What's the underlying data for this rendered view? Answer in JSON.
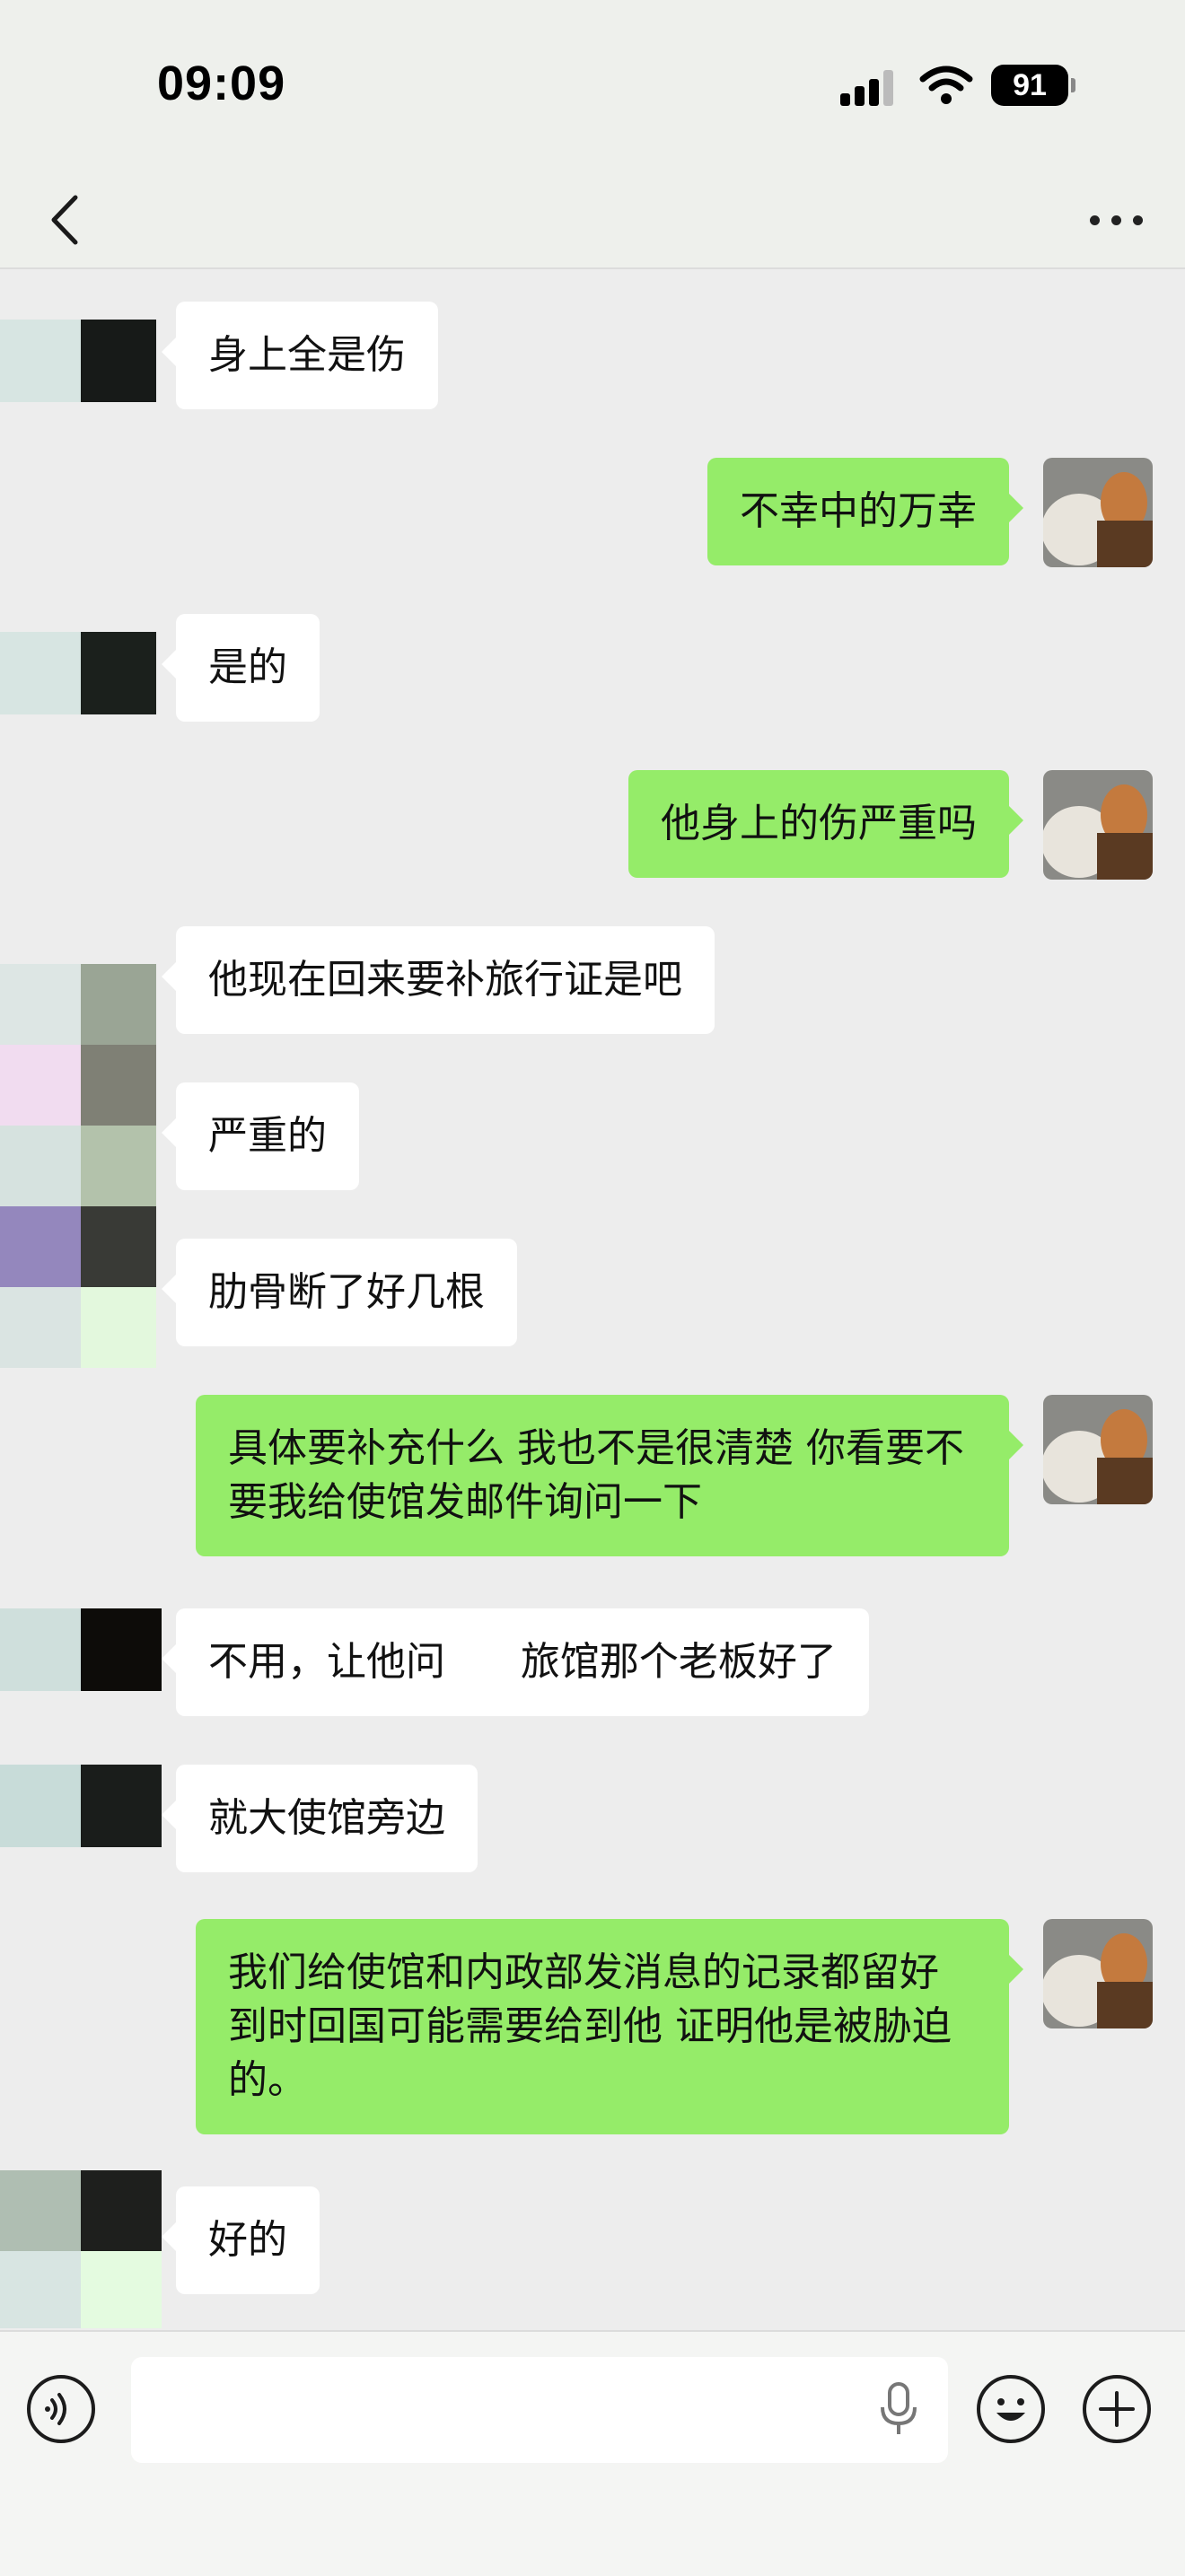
{
  "status_bar": {
    "time": "09:09",
    "battery": "91"
  },
  "messages": [
    {
      "side": "in",
      "text": "身上全是伤"
    },
    {
      "side": "out",
      "text": "不幸中的万幸"
    },
    {
      "side": "in",
      "text": "是的"
    },
    {
      "side": "out",
      "text": "他身上的伤严重吗"
    },
    {
      "side": "in",
      "text": "他现在回来要补旅行证是吧"
    },
    {
      "side": "in",
      "text": "严重的"
    },
    {
      "side": "in",
      "text": "肋骨断了好几根"
    },
    {
      "side": "out",
      "text": "具体要补充什么 我也不是很清楚 你看要不要我给使馆发邮件询问一下"
    },
    {
      "side": "in",
      "text": "不用，让他问      旅馆那个老板好了"
    },
    {
      "side": "in",
      "text": "就大使馆旁边"
    },
    {
      "side": "out",
      "text": "我们给使馆和内政部发消息的记录都留好 到时回国可能需要给到他 证明他是被胁迫的。"
    },
    {
      "side": "in",
      "text": "好的"
    }
  ],
  "colors": {
    "bubble_out": "#95ec69",
    "bubble_in": "#ffffff",
    "background": "#ededed"
  },
  "icons": {
    "back": "chevron-left-icon",
    "more": "more-dots-icon",
    "voice": "voice-icon",
    "mic": "mic-icon",
    "emoji": "emoji-icon",
    "plus": "plus-icon"
  }
}
